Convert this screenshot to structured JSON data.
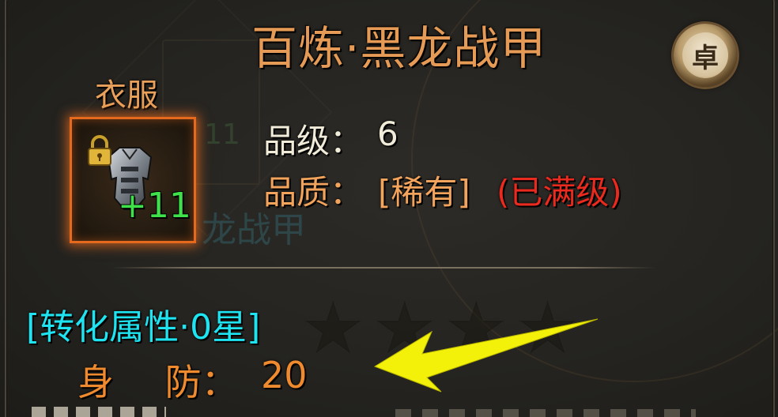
{
  "item": {
    "name": "百炼·黑龙战甲",
    "slot_label": "衣服",
    "enhance_level": "+11",
    "locked": true,
    "badge_char": "卓"
  },
  "stats": {
    "grade_label": "品级：",
    "grade_value": "6",
    "quality_label": "品质：",
    "quality_value": "[稀有]",
    "quality_status": "(已满级)"
  },
  "conversion": {
    "title": "[转化属性·0星]",
    "defense_label": "身 防：",
    "defense_value": "20",
    "stars_filled": 0,
    "stars_total": 4
  },
  "background_ghost": {
    "name_fragment": "龙战甲",
    "level_fragment": "11"
  },
  "colors": {
    "title": "#e59a55",
    "slot_border": "#e56a1e",
    "enhance": "#3fe04a",
    "quality": "#f2a35c",
    "maxed": "#ea2a1e",
    "conversion_title": "#1ee3f0",
    "defense": "#ef8a2e",
    "arrow": "#f3f00a"
  },
  "icons": {
    "lock": "padlock-icon",
    "item": "armor-icon",
    "badge": "rank-badge-icon",
    "pointer": "yellow-arrow-annotation"
  }
}
